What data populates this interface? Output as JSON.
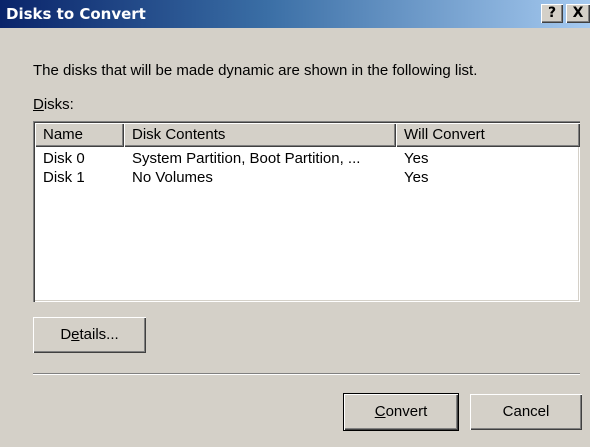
{
  "window": {
    "title": "Disks to Convert",
    "help_label": "?",
    "close_label": "X"
  },
  "description": "The disks that will be made dynamic are shown in the following list.",
  "disks_label": {
    "mnemonic": "D",
    "rest": "isks:"
  },
  "listview": {
    "columns": [
      "Name",
      "Disk Contents",
      "Will Convert"
    ],
    "rows": [
      [
        "Disk 0",
        "System Partition, Boot Partition, ...",
        "Yes"
      ],
      [
        "Disk 1",
        "No Volumes",
        "Yes"
      ]
    ]
  },
  "buttons": {
    "details": {
      "before": "D",
      "mnemonic": "e",
      "after": "tails..."
    },
    "convert": {
      "mnemonic": "C",
      "after": "onvert"
    },
    "cancel": "Cancel"
  },
  "colors": {
    "dialog_bg": "#d4d0c8",
    "titlebar_start": "#0a246a",
    "titlebar_end": "#a6caf0",
    "list_bg": "#ffffff"
  }
}
